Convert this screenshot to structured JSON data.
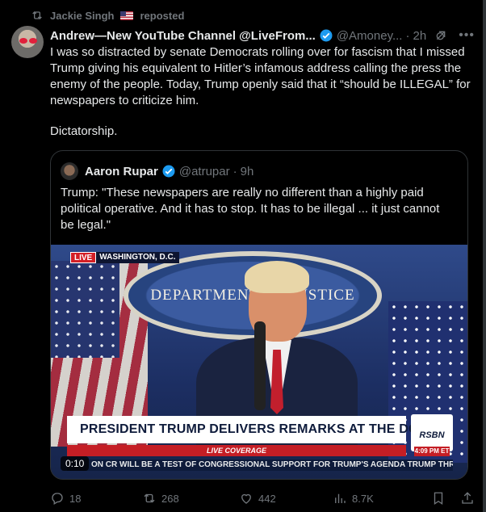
{
  "repost": {
    "user": "Jackie Singh",
    "label": "reposted"
  },
  "tweet": {
    "author": "Andrew—New YouTube Channel @LiveFrom...",
    "handle": "@Amoney...",
    "time": "2h",
    "text_p1": "I was so distracted by senate Democrats rolling over for fascism that I missed Trump giving his equivalent to Hitler’s infamous address calling the press the enemy of the people. Today, Trump openly said that it “should be ILLEGAL” for newspapers to criticize him.",
    "text_p2": "Dictatorship."
  },
  "quote": {
    "author": "Aaron Rupar",
    "handle": "@atrupar",
    "time": "9h",
    "text": "Trump: \"These newspapers are really no different than a highly paid political operative. And it has to stop. It has to be illegal ... it just cannot be legal.\"",
    "video": {
      "live": "LIVE",
      "location": "WASHINGTON, D.C.",
      "seal_text": "DEPARTMENT OF JUSTICE",
      "headline": "PRESIDENT TRUMP DELIVERS REMARKS AT THE DOJ",
      "live_coverage": "LIVE COVERAGE",
      "network": "RSBN",
      "clock": "4:09 PM ET",
      "ticker": "ON CR WILL BE A TEST OF CONGRESSIONAL SUPPORT FOR TRUMP'S AGENDA    TRUMP THR",
      "duration": "0:10"
    }
  },
  "actions": {
    "replies": "18",
    "reposts": "268",
    "likes": "442",
    "views": "8.7K"
  },
  "colors": {
    "background": "#000000",
    "text": "#e7e9ea",
    "muted": "#71767b",
    "verified": "#1d9bf0"
  }
}
